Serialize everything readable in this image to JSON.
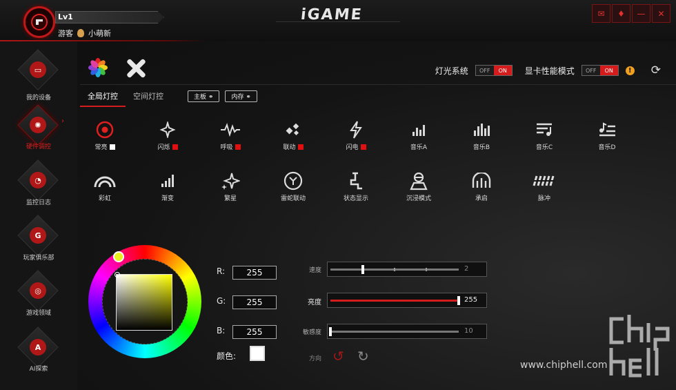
{
  "user": {
    "level": "Lv1",
    "role": "游客",
    "name": "小萌新"
  },
  "brand": {
    "logo": "iGAME",
    "accent": "#d41c1c"
  },
  "window_buttons": [
    "gift-icon",
    "skin-icon",
    "minimize-icon",
    "close-icon"
  ],
  "sidebar": {
    "items": [
      {
        "label": "我的设备",
        "icon": "monitor-icon",
        "active": false
      },
      {
        "label": "硬件调控",
        "icon": "fan-icon",
        "active": true
      },
      {
        "label": "监控日志",
        "icon": "gauge-icon",
        "active": false
      },
      {
        "label": "玩家俱乐部",
        "icon": "club-icon",
        "active": false
      },
      {
        "label": "游戏领域",
        "icon": "gamepad-icon",
        "active": false
      },
      {
        "label": "AI探索",
        "icon": "ai-icon",
        "active": false
      }
    ]
  },
  "header": {
    "light_system_label": "灯光系统",
    "light_toggle": {
      "off": "OFF",
      "on": "ON"
    },
    "perf_mode_label": "显卡性能模式",
    "perf_toggle": {
      "off": "OFF",
      "on": "ON"
    },
    "warn_symbol": "!"
  },
  "tabs": [
    {
      "label": "全局灯控",
      "active": true
    },
    {
      "label": "空间灯控",
      "active": false
    }
  ],
  "tag_buttons": [
    {
      "label": "主板"
    },
    {
      "label": "内存"
    }
  ],
  "effects": [
    {
      "label": "常亮",
      "icon": "target-icon",
      "swatch": "#ffffff"
    },
    {
      "label": "闪烁",
      "icon": "sparkle-icon",
      "swatch": "#e01010"
    },
    {
      "label": "呼吸",
      "icon": "pulse-icon",
      "swatch": "#e01010"
    },
    {
      "label": "联动",
      "icon": "link-icon",
      "swatch": "#e01010"
    },
    {
      "label": "闪电",
      "icon": "lightning-icon",
      "swatch": "#e01010"
    },
    {
      "label": "音乐A",
      "icon": "music-bars-icon",
      "swatch": ""
    },
    {
      "label": "音乐B",
      "icon": "music-bars-b-icon",
      "swatch": ""
    },
    {
      "label": "音乐C",
      "icon": "music-note-c-icon",
      "swatch": ""
    },
    {
      "label": "音乐D",
      "icon": "music-note-d-icon",
      "swatch": ""
    },
    {
      "label": "彩虹",
      "icon": "rainbow-icon",
      "swatch": ""
    },
    {
      "label": "渐变",
      "icon": "gradient-bars-icon",
      "swatch": ""
    },
    {
      "label": "繁星",
      "icon": "stars-icon",
      "swatch": ""
    },
    {
      "label": "雷蛇联动",
      "icon": "razer-icon",
      "swatch": ""
    },
    {
      "label": "状态显示",
      "icon": "status-icon",
      "swatch": ""
    },
    {
      "label": "沉浸模式",
      "icon": "immersive-icon",
      "swatch": ""
    },
    {
      "label": "承启",
      "icon": "arch-icon",
      "swatch": ""
    },
    {
      "label": "脉冲",
      "icon": "pulse-waves-icon",
      "swatch": ""
    }
  ],
  "color": {
    "r_label": "R:",
    "g_label": "G:",
    "b_label": "B:",
    "r": "255",
    "g": "255",
    "b": "255",
    "color_label": "颜色:",
    "current": "#ffffff"
  },
  "sliders": {
    "speed": {
      "label": "速度",
      "value": "2",
      "fraction": 0.25
    },
    "brightness": {
      "label": "亮度",
      "value": "255",
      "fraction": 1.0
    },
    "sensitivity": {
      "label": "敏感度",
      "value": "10",
      "fraction": 0.0
    }
  },
  "direction": {
    "label": "方向"
  },
  "watermark": {
    "site": "www.chiphell.com",
    "logo_text": "chip hell"
  }
}
